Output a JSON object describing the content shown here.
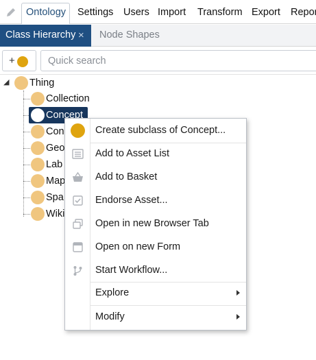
{
  "menubar": {
    "tabs": [
      "Ontology",
      "Settings",
      "Users",
      "Import",
      "Transform",
      "Export",
      "Repor"
    ],
    "active_tab": "Ontology"
  },
  "subtabs": {
    "active": "Class Hierarchy",
    "close_glyph": "×",
    "inactive": "Node Shapes"
  },
  "toolbar": {
    "add_label": "+",
    "search_placeholder": "Quick search"
  },
  "tree": {
    "root": "Thing",
    "children": [
      "Collection",
      "Concept",
      "Con",
      "Geo",
      "Lab",
      "Map",
      "Spa",
      "Wiki"
    ],
    "selected": "Concept"
  },
  "context_menu": {
    "items": [
      {
        "label": "Create subclass of Concept...",
        "icon": "class-ball-icon"
      },
      {
        "label": "Add to Asset List",
        "icon": "list-icon"
      },
      {
        "label": "Add to Basket",
        "icon": "basket-icon"
      },
      {
        "label": "Endorse Asset...",
        "icon": "checkbox-icon"
      },
      {
        "label": "Open in new Browser Tab",
        "icon": "new-tab-icon"
      },
      {
        "label": "Open on new Form",
        "icon": "form-icon"
      },
      {
        "label": "Start Workflow...",
        "icon": "workflow-icon"
      },
      {
        "label": "Explore",
        "icon": "",
        "submenu": true
      },
      {
        "label": "Modify",
        "icon": "",
        "submenu": true
      }
    ]
  },
  "colors": {
    "active_tab_bg": "#1f4f82",
    "selection_bg": "#17365d",
    "class_ball": "#f0c67f",
    "class_ball_dark": "#dfa40f"
  }
}
